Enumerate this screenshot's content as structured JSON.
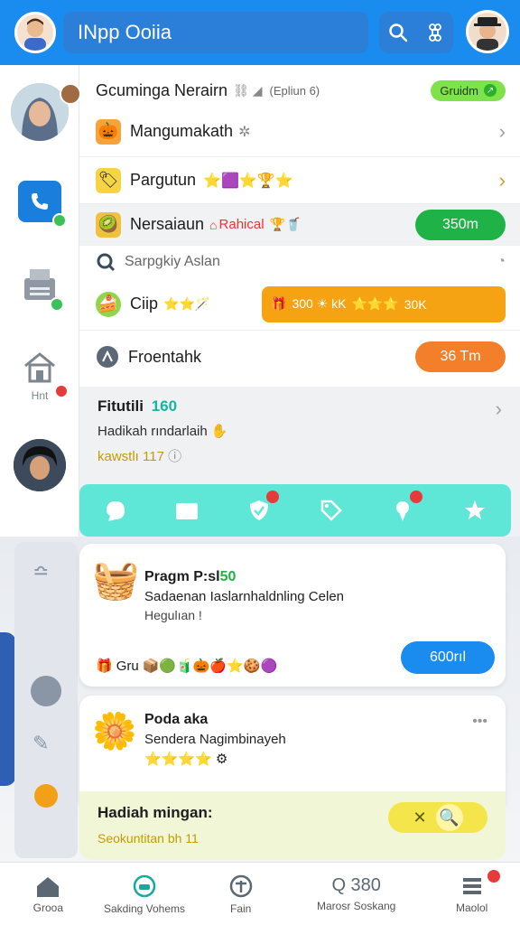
{
  "header": {
    "app_title": "INpp Ooiia"
  },
  "sidebar": {
    "home_label": "Hnt",
    "home_badge": "!"
  },
  "list": {
    "row1": {
      "label": "Gcuminga Nerairn",
      "sub": "(Epliun 6)",
      "badge": "Gruidm"
    },
    "row2": {
      "label": "Mangumakath"
    },
    "row3": {
      "label": "Pargutun"
    },
    "row4": {
      "label": "Nersaiaun",
      "sub": "Rahical",
      "button": "350m"
    },
    "row5": {
      "label": "Sarpgkiy Aslan"
    },
    "row6": {
      "label": "Ciip",
      "bar_text": "300 ☀ kK",
      "bar_suffix": "30K"
    },
    "row7": {
      "label": "Froentahk",
      "button": "36 Tm"
    }
  },
  "feature": {
    "title": "Fitutili",
    "tag": "160",
    "line": "Hadikah rındarlaih",
    "meta": "kawstlı 117"
  },
  "promo_card": {
    "title": "Pragm P:sl",
    "title_tag": "50",
    "line1": "Sadaenan Iaslarnhaldnling Celen",
    "line2": "Hegulıan !",
    "gift_label": "Gru",
    "button": "600rıl"
  },
  "product_card": {
    "title": "Poda aka",
    "line1": "Sendera Nagimbinayeh",
    "more": "•••"
  },
  "weekly": {
    "heading": "Hadiah mingan:",
    "sub": "Seokuntitan bh 11",
    "close": "✕"
  },
  "bottom_nav": [
    {
      "label": "Grooa"
    },
    {
      "label": "Sakding Vohems"
    },
    {
      "label": "Fain"
    },
    {
      "label": "Q 380",
      "sub": "Marosr Soskang"
    },
    {
      "label": "Maolol"
    }
  ],
  "colors": {
    "primary": "#1a8cf0",
    "green": "#1fb347",
    "orange": "#f3a316",
    "teal": "#5ee6d7",
    "accent_yellow": "#c49a07"
  }
}
